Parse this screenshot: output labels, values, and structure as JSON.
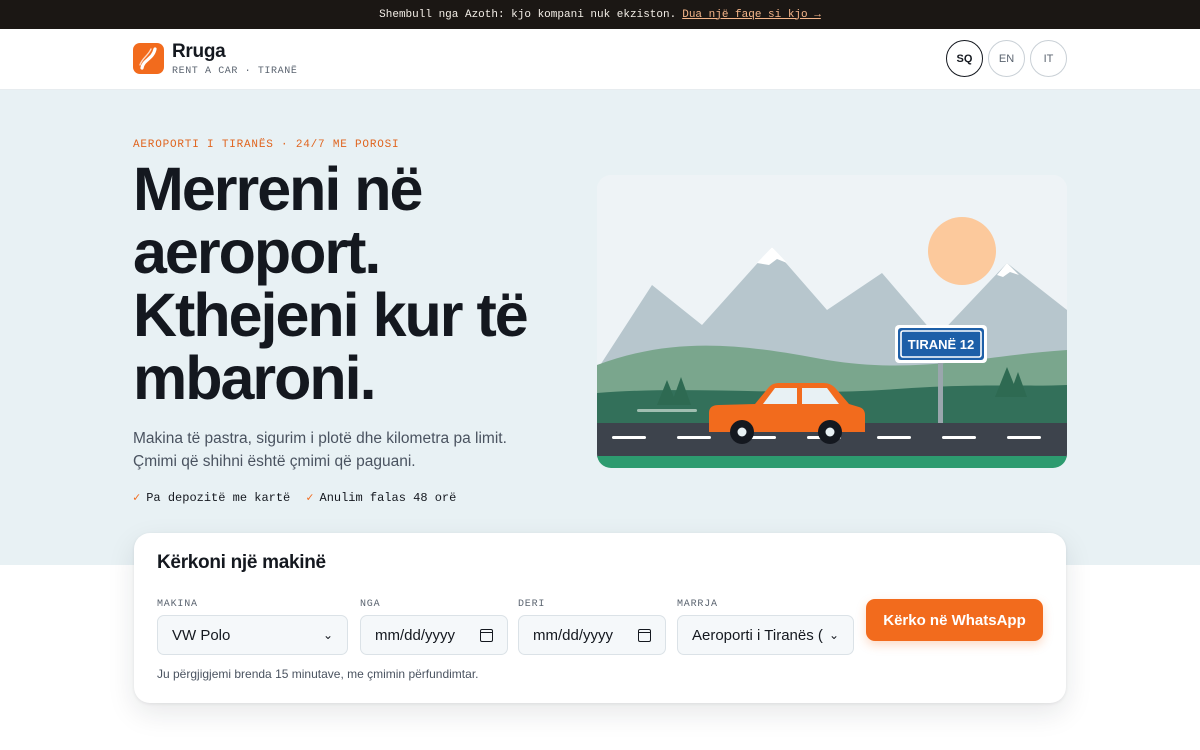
{
  "announcement": {
    "text": "Shembull nga Azoth: kjo kompani nuk ekziston.",
    "link": "Dua një faqe si kjo →"
  },
  "header": {
    "brand": "Rruga",
    "tagline": "RENT A CAR · TIRANË",
    "logo_icon": "road-logo-icon",
    "languages": [
      {
        "code": "SQ",
        "active": true
      },
      {
        "code": "EN",
        "active": false
      },
      {
        "code": "IT",
        "active": false
      }
    ]
  },
  "hero": {
    "eyebrow": "AEROPORTI I TIRANËS · 24/7 ME POROSI",
    "headline": "Merreni në aeroport. Kthejeni kur të mbaroni.",
    "lead": "Makina të pastra, sigurim i plotë dhe kilometra pa limit. Çmimi që shihni është çmimi që paguani.",
    "checks": [
      "Pa depozitë me kartë",
      "Anulim falas 48 orë"
    ],
    "illustration": {
      "sign_text": "TIRANË 12"
    }
  },
  "search": {
    "title": "Kërkoni një makinë",
    "fields": {
      "car": {
        "label": "MAKINA",
        "value": "VW Polo"
      },
      "from": {
        "label": "NGA",
        "value": "mm/dd/yyyy"
      },
      "to": {
        "label": "DERI",
        "value": "mm/dd/yyyy"
      },
      "pickup": {
        "label": "MARRJA",
        "value": "Aeroporti i Tiranës (TI"
      }
    },
    "cta": "Kërko në WhatsApp",
    "note": "Ju përgjigjemi brenda 15 minutave, me çmimin përfundimtar."
  },
  "colors": {
    "accent": "#f26b1d",
    "dark": "#14181f",
    "hero_bg": "#e8f1f4",
    "topbar_bg": "#1b1714",
    "sign_blue": "#1d5fa8"
  }
}
